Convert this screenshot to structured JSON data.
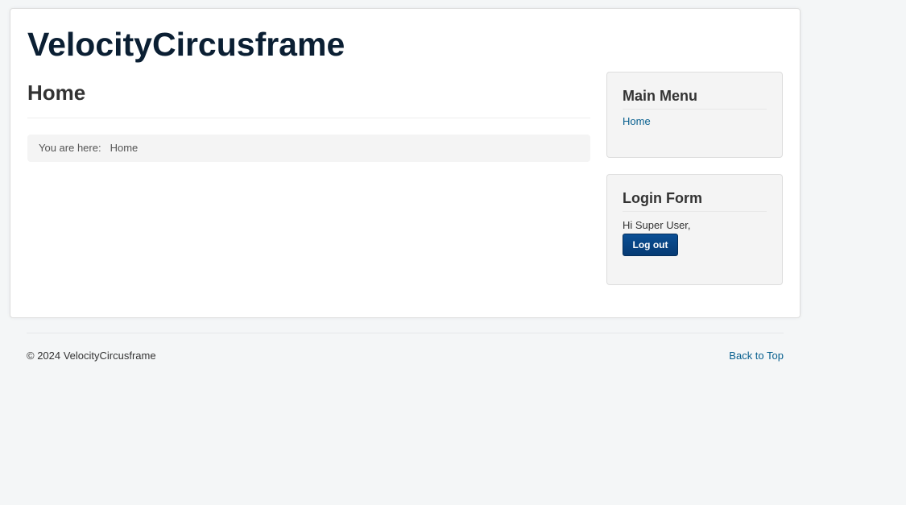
{
  "site": {
    "brand": "VelocityCircusframe"
  },
  "main": {
    "page_title": "Home",
    "breadcrumb": {
      "prefix": "You are here:",
      "current": "Home"
    }
  },
  "sidebar": {
    "main_menu": {
      "title": "Main Menu",
      "items": [
        {
          "label": "Home"
        }
      ]
    },
    "login_form": {
      "title": "Login Form",
      "greeting": "Hi Super User,",
      "logout_label": "Log out"
    }
  },
  "footer": {
    "copyright": "© 2024 VelocityCircusframe",
    "back_to_top": "Back to Top"
  },
  "colors": {
    "background": "#f4f6f7",
    "link": "#08608f",
    "button": "#063a73",
    "brand": "#0b1f33"
  }
}
